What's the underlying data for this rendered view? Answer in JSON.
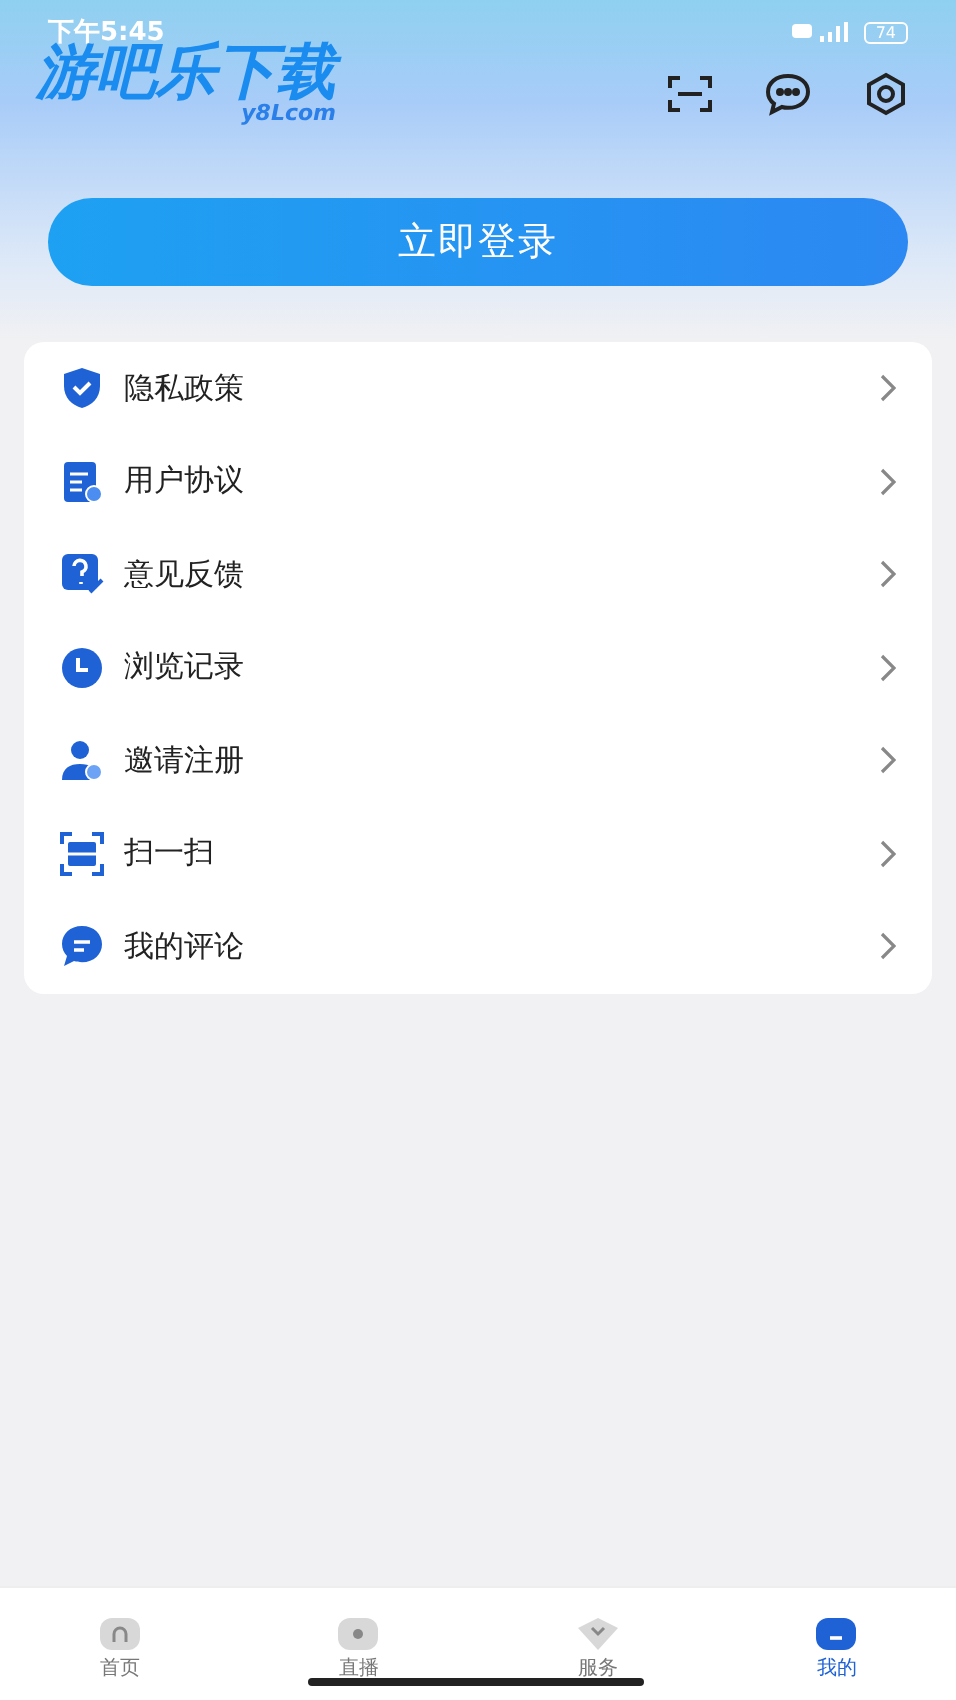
{
  "status_bar": {
    "time": "下午5:45",
    "battery": "74"
  },
  "logo": {
    "title": "游吧乐下载",
    "subtitle": "y8Lcom"
  },
  "login_button": "立即登录",
  "menu": [
    {
      "kind": "shield",
      "label": "隐私政策"
    },
    {
      "kind": "doc",
      "label": "用户协议"
    },
    {
      "kind": "question",
      "label": "意见反馈"
    },
    {
      "kind": "clock",
      "label": "浏览记录"
    },
    {
      "kind": "person",
      "label": "邀请注册"
    },
    {
      "kind": "scan",
      "label": "扫一扫"
    },
    {
      "kind": "comment",
      "label": "我的评论"
    }
  ],
  "tabs": [
    {
      "kind": "home",
      "label": "首页",
      "selected": false
    },
    {
      "kind": "live",
      "label": "直播",
      "selected": false
    },
    {
      "kind": "service",
      "label": "服务",
      "selected": false
    },
    {
      "kind": "mine",
      "label": "我的",
      "selected": true
    }
  ]
}
